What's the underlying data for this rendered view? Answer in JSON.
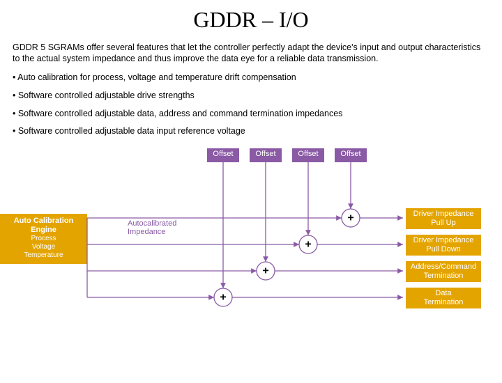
{
  "title": "GDDR – I/O",
  "intro": "GDDR 5 SGRAMs offer several features that let the controller perfectly adapt the device's input and output characteristics to the actual system impedance and thus improve the data eye for a reliable data transmission.",
  "bullets": [
    "• Auto calibration for process, voltage and temperature drift compensation",
    "• Software controlled adjustable drive strengths",
    "• Software controlled adjustable data, address and command termination impedances",
    "• Software controlled adjustable data input reference voltage"
  ],
  "diagram": {
    "engine": {
      "title": "Auto Calibration Engine",
      "lines": [
        "Process",
        "Voltage",
        "Temperature"
      ]
    },
    "autocal": {
      "l1": "Autocalibrated",
      "l2": "Impedance"
    },
    "offsets": [
      "Offset",
      "Offset",
      "Offset",
      "Offset"
    ],
    "adder": "+",
    "outputs": [
      {
        "l1": "Driver Impedance",
        "l2": "Pull Up"
      },
      {
        "l1": "Driver Impedance",
        "l2": "Pull Down"
      },
      {
        "l1": "Address/Command",
        "l2": "Termination"
      },
      {
        "l1": "Data",
        "l2": "Termination"
      }
    ]
  }
}
